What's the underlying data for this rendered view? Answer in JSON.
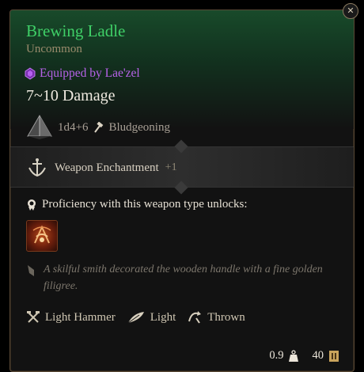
{
  "item": {
    "name": "Brewing Ladle",
    "rarity": "Uncommon",
    "equipped": "Equipped by Lae'zel",
    "damage": "7~10 Damage",
    "dice": "1d4+6",
    "damage_type": "Bludgeoning"
  },
  "enchantment": {
    "label": "Weapon Enchantment",
    "bonus": "+1"
  },
  "proficiency": {
    "text": "Proficiency with this weapon type unlocks:"
  },
  "description": "A skilful smith decorated the wooden handle with a fine golden filigree.",
  "properties": [
    {
      "label": "Light Hammer",
      "icon": "crossed-hammers-icon"
    },
    {
      "label": "Light",
      "icon": "feather-icon"
    },
    {
      "label": "Thrown",
      "icon": "thrown-arc-icon"
    }
  ],
  "footer": {
    "weight": "0.9",
    "value": "40"
  },
  "colors": {
    "name": "#3fcf67",
    "rarity": "#9b8c6d",
    "equipped": "#b662e8",
    "border": "#5a4a36"
  }
}
